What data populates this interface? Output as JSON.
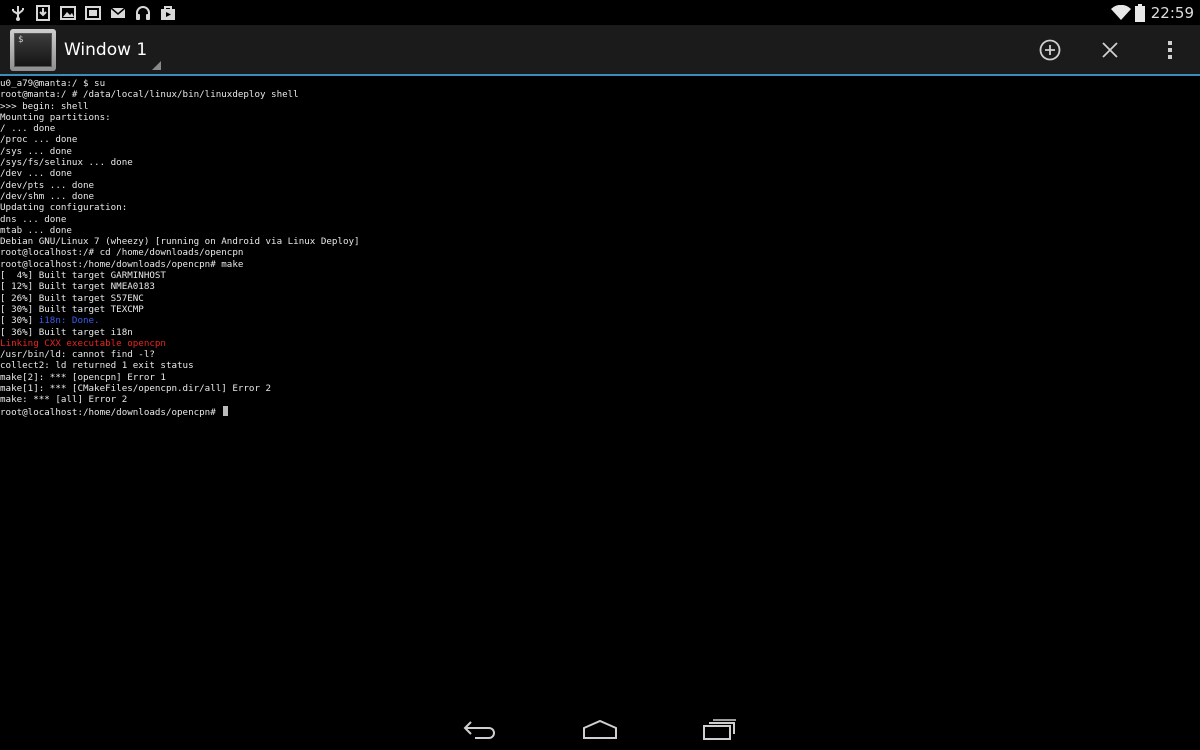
{
  "status_bar": {
    "icons_left": [
      "usb-icon",
      "download-icon",
      "image-icon",
      "screenshot-icon",
      "email-icon",
      "headset-icon",
      "store-icon"
    ],
    "icons_right": [
      "wifi-icon",
      "battery-icon"
    ],
    "time": "22:59"
  },
  "action_bar": {
    "window_title": "Window 1",
    "app_icon_glyph": "$",
    "actions": [
      "add-window-icon",
      "close-window-icon",
      "overflow-menu-icon"
    ]
  },
  "terminal": {
    "lines": [
      {
        "text": "u0_a79@manta:/ $ su",
        "color": "#e8e8e8"
      },
      {
        "text": "root@manta:/ # /data/local/linux/bin/linuxdeploy shell",
        "color": "#e8e8e8"
      },
      {
        "text": ">>> begin: shell",
        "color": "#e8e8e8"
      },
      {
        "text": "Mounting partitions:",
        "color": "#e8e8e8"
      },
      {
        "text": "/ ... done",
        "color": "#e8e8e8"
      },
      {
        "text": "/proc ... done",
        "color": "#e8e8e8"
      },
      {
        "text": "/sys ... done",
        "color": "#e8e8e8"
      },
      {
        "text": "/sys/fs/selinux ... done",
        "color": "#e8e8e8"
      },
      {
        "text": "/dev ... done",
        "color": "#e8e8e8"
      },
      {
        "text": "/dev/pts ... done",
        "color": "#e8e8e8"
      },
      {
        "text": "/dev/shm ... done",
        "color": "#e8e8e8"
      },
      {
        "text": "Updating configuration:",
        "color": "#e8e8e8"
      },
      {
        "text": "dns ... done",
        "color": "#e8e8e8"
      },
      {
        "text": "mtab ... done",
        "color": "#e8e8e8"
      },
      {
        "text": "Debian GNU/Linux 7 (wheezy) [running on Android via Linux Deploy]",
        "color": "#e8e8e8"
      },
      {
        "text": "root@localhost:/# cd /home/downloads/opencpn",
        "color": "#e8e8e8"
      },
      {
        "text": "root@localhost:/home/downloads/opencpn# make",
        "color": "#e8e8e8"
      },
      {
        "text": "[  4%] Built target GARMINHOST",
        "color": "#e8e8e8"
      },
      {
        "text": "[ 12%] Built target NMEA0183",
        "color": "#e8e8e8"
      },
      {
        "text": "[ 26%] Built target S57ENC",
        "color": "#e8e8e8"
      },
      {
        "text": "[ 30%] Built target TEXCMP",
        "color": "#e8e8e8"
      },
      {
        "text": "[ 30%] ",
        "color": "#e8e8e8",
        "extra": "i18n: Done.",
        "extra_color": "#3b5cf0"
      },
      {
        "text": "[ 36%] Built target i18n",
        "color": "#e8e8e8"
      },
      {
        "text": "Linking CXX executable opencpn",
        "color": "#e8241e"
      },
      {
        "text": "/usr/bin/ld: cannot find -l?",
        "color": "#e8e8e8"
      },
      {
        "text": "collect2: ld returned 1 exit status",
        "color": "#e8e8e8"
      },
      {
        "text": "make[2]: *** [opencpn] Error 1",
        "color": "#e8e8e8"
      },
      {
        "text": "make[1]: *** [CMakeFiles/opencpn.dir/all] Error 2",
        "color": "#e8e8e8"
      },
      {
        "text": "make: *** [all] Error 2",
        "color": "#e8e8e8"
      },
      {
        "text": "root@localhost:/home/downloads/opencpn# ",
        "color": "#e8e8e8",
        "cursor": true
      }
    ]
  },
  "nav_bar": {
    "buttons": [
      "back-icon",
      "home-icon",
      "recent-apps-icon"
    ]
  },
  "colors": {
    "accent_line": "#3a8fb7",
    "action_bar_bg": "#1b1b1b",
    "error_text": "#e8241e",
    "info_text": "#3b5cf0"
  }
}
